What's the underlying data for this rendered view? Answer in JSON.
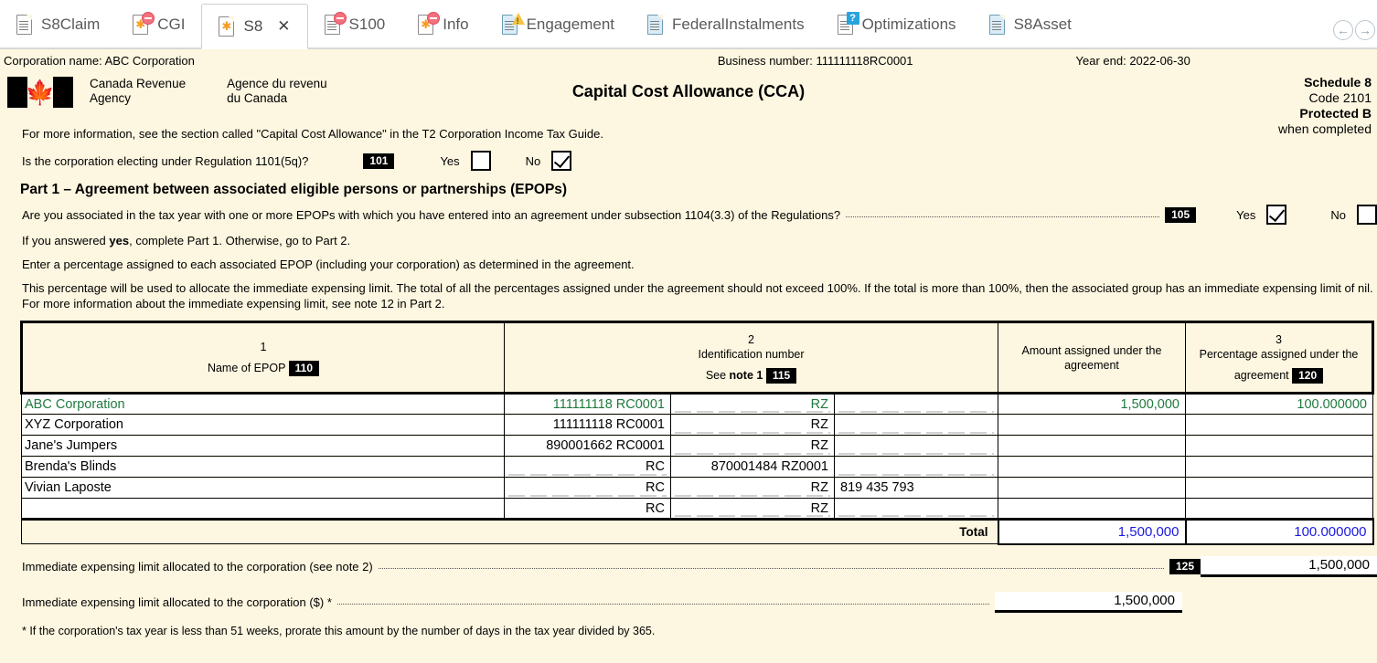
{
  "tabs": [
    {
      "label": "S8Claim",
      "icon": "document-icon",
      "badge": "none",
      "active": false,
      "closable": false
    },
    {
      "label": "CGI",
      "icon": "document-star-icon",
      "badge": "minus",
      "active": false,
      "closable": false
    },
    {
      "label": "S8",
      "icon": "document-star-icon",
      "badge": "none",
      "active": true,
      "closable": true
    },
    {
      "label": "S100",
      "icon": "document-lines-icon",
      "badge": "minus",
      "active": false,
      "closable": false
    },
    {
      "label": "Info",
      "icon": "document-star-icon",
      "badge": "minus",
      "active": false,
      "closable": false
    },
    {
      "label": "Engagement",
      "icon": "document-blue-icon",
      "badge": "warning",
      "active": false,
      "closable": false
    },
    {
      "label": "FederalInstalments",
      "icon": "document-blue-icon",
      "badge": "none",
      "active": false,
      "closable": false
    },
    {
      "label": "Optimizations",
      "icon": "document-lines-icon",
      "badge": "question",
      "active": false,
      "closable": false
    },
    {
      "label": "S8Asset",
      "icon": "document-blue-icon",
      "badge": "none",
      "active": false,
      "closable": false
    }
  ],
  "nav": {
    "prev": "←",
    "next": "→"
  },
  "close_glyph": "✕",
  "infobar": {
    "corporation_name": "Corporation name: ABC Corporation",
    "business_number": "Business number: 111111118RC0001",
    "year_end": "Year end: 2022-06-30"
  },
  "header": {
    "agency_en": "Canada Revenue\nAgency",
    "agency_fr": "Agence du revenu\ndu Canada",
    "title": "Capital Cost Allowance (CCA)",
    "schedule": "Schedule 8",
    "code": "Code 2101",
    "protected": "Protected B",
    "protected_sub": "when completed"
  },
  "intro": {
    "more_info": "For more information, see the section called \"Capital Cost Allowance\" in the T2 Corporation Income Tax Guide.",
    "reg_question": "Is the corporation electing under Regulation 1101(5q)?",
    "reg_code": "101",
    "yes_label": "Yes",
    "no_label": "No",
    "reg_yes_checked": false,
    "reg_no_checked": true
  },
  "part1": {
    "heading": "Part 1 – Agreement between associated eligible persons or partnerships (EPOPs)",
    "question": "Are you associated in the tax year with one or more EPOPs with which you have entered into an agreement under subsection 1104(3.3) of the Regulations?",
    "question_code": "105",
    "yes_label": "Yes",
    "no_label": "No",
    "assoc_yes_checked": true,
    "assoc_no_checked": false,
    "note_if_yes": "If you answered yes, complete Part 1. Otherwise, go to Part 2.",
    "note_if_yes_pre": "If you answered ",
    "note_if_yes_bold": "yes",
    "note_if_yes_post": ", complete Part 1. Otherwise, go to Part 2.",
    "enter_percentage": "Enter a percentage assigned to each associated EPOP (including your corporation) as determined in the agreement.",
    "long_note": "This percentage will be used to allocate the immediate expensing limit. The total of all the percentages assigned under the agreement should not exceed 100%. If the total is more than 100%, then the associated group has an immediate expensing limit of nil. For more information about the immediate expensing limit, see note 12 in Part 2."
  },
  "table": {
    "columns": [
      {
        "num": "1",
        "title": "Name of EPOP",
        "sub": "",
        "code": "110"
      },
      {
        "num": "2",
        "title": "Identification number",
        "sub": "See note 1",
        "code": "115"
      },
      {
        "num": "",
        "title": "Amount assigned under the agreement",
        "sub": "",
        "code": ""
      },
      {
        "num": "3",
        "title": "Percentage assigned under the agreement",
        "sub": "",
        "code": "120"
      }
    ],
    "see_label": "See ",
    "note1_bold": "note 1",
    "rows": [
      {
        "name": "ABC Corporation",
        "rc": "111111118 RC0001",
        "rz": "RZ",
        "extra": "",
        "amount": "1,500,000",
        "percent": "100.000000",
        "color": "green"
      },
      {
        "name": "XYZ Corporation",
        "rc": "111111118 RC0001",
        "rz": "RZ",
        "extra": "",
        "amount": "",
        "percent": "",
        "color": "black"
      },
      {
        "name": "Jane's Jumpers",
        "rc": "890001662 RC0001",
        "rz": "RZ",
        "extra": "",
        "amount": "",
        "percent": "",
        "color": "black"
      },
      {
        "name": "Brenda's Blinds",
        "rc": "RC",
        "rz": "870001484 RZ0001",
        "extra": "",
        "amount": "",
        "percent": "",
        "color": "black"
      },
      {
        "name": "Vivian Laposte",
        "rc": "RC",
        "rz": "RZ",
        "extra": "819 435 793",
        "amount": "",
        "percent": "",
        "color": "black"
      },
      {
        "name": "",
        "rc": "RC",
        "rz": "RZ",
        "extra": "",
        "amount": "",
        "percent": "",
        "color": "black"
      }
    ],
    "total_label": "Total",
    "total_amount": "1,500,000",
    "total_percent": "100.000000"
  },
  "bottom": {
    "line1_label": "Immediate expensing limit allocated to the corporation (see note 2)",
    "line1_code": "125",
    "line1_value": "1,500,000",
    "line2_label": "Immediate expensing limit allocated to the corporation ($) *",
    "line2_value": "1,500,000",
    "footnote": "* If the corporation's tax year is less than 51 weeks, prorate this amount by the number of days in the tax year divided by 365."
  }
}
